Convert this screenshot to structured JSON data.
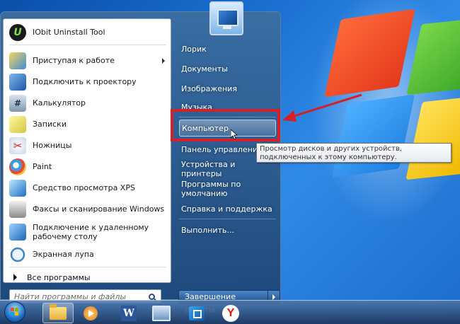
{
  "start_menu": {
    "programs": [
      {
        "label": "IObit Uninstall Tool",
        "icon": "iobit-icon",
        "has_submenu": false
      },
      {
        "label": "Приступая к работе",
        "icon": "getting-started-icon",
        "has_submenu": true
      },
      {
        "label": "Подключить к проектору",
        "icon": "projector-icon",
        "has_submenu": false
      },
      {
        "label": "Калькулятор",
        "icon": "calculator-icon",
        "has_submenu": false
      },
      {
        "label": "Записки",
        "icon": "sticky-notes-icon",
        "has_submenu": false
      },
      {
        "label": "Ножницы",
        "icon": "snipping-tool-icon",
        "has_submenu": false
      },
      {
        "label": "Paint",
        "icon": "paint-icon",
        "has_submenu": false
      },
      {
        "label": "Средство просмотра XPS",
        "icon": "xps-viewer-icon",
        "has_submenu": false
      },
      {
        "label": "Факсы и сканирование Windows",
        "icon": "fax-scan-icon",
        "has_submenu": false
      },
      {
        "label": "Подключение к удаленному рабочему столу",
        "icon": "remote-desktop-icon",
        "has_submenu": false
      },
      {
        "label": "Экранная лупа",
        "icon": "magnifier-icon",
        "has_submenu": false
      }
    ],
    "all_programs_label": "Все программы",
    "search_placeholder": "Найти программы и файлы",
    "right_items": [
      {
        "label": "Лорик"
      },
      {
        "label": "Документы"
      },
      {
        "label": "Изображения"
      },
      {
        "label": "Музыка"
      },
      {
        "label": "Компьютер",
        "hover": true
      },
      {
        "label": "Панель управления"
      },
      {
        "label": "Устройства и принтеры"
      },
      {
        "label": "Программы по умолчанию"
      },
      {
        "label": "Справка и поддержка"
      },
      {
        "label": "Выполнить..."
      }
    ],
    "shutdown_label": "Завершение работы"
  },
  "tooltip": {
    "text": "Просмотр дисков и других устройств, подключенных к этому компьютеру."
  },
  "annotation": {
    "color": "#d42027"
  },
  "taskbar": {
    "buttons": [
      {
        "name": "explorer-icon",
        "active": true
      },
      {
        "name": "media-player-icon",
        "active": false
      },
      {
        "name": "word-icon",
        "active": false
      },
      {
        "name": "network-icon",
        "active": false
      },
      {
        "name": "remote-connection-icon",
        "active": false
      },
      {
        "name": "yandex-browser-icon",
        "active": false
      }
    ]
  }
}
